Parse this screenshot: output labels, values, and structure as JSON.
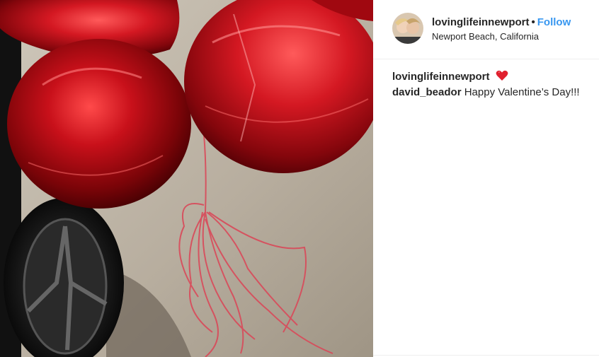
{
  "post": {
    "username": "lovinglifeinnewport",
    "separator": "•",
    "follow_label": "Follow",
    "location": "Newport Beach, California"
  },
  "comments": [
    {
      "username": "lovinglifeinnewport",
      "text": "",
      "emoji": "heart-icon"
    },
    {
      "username": "david_beador",
      "text": "Happy Valentine’s Day!!!"
    }
  ],
  "colors": {
    "follow": "#3897f0",
    "text": "#262626",
    "balloon": "#c0121a",
    "heart": "#e0202e"
  }
}
